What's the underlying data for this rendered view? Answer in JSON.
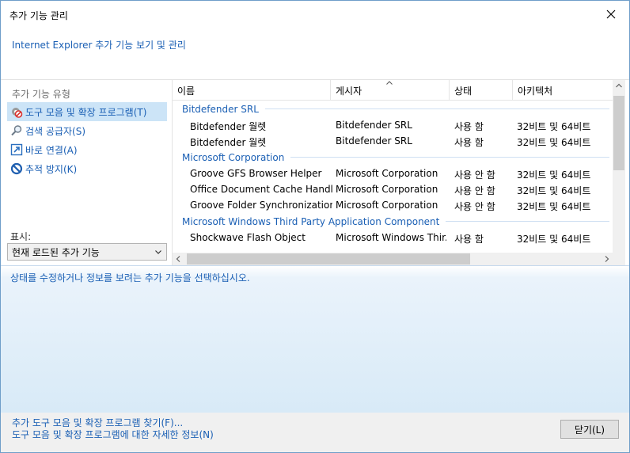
{
  "window": {
    "title": "추가 기능 관리"
  },
  "header": {
    "link": "Internet Explorer 추가 기능 보기 및 관리"
  },
  "left_panel": {
    "heading": "추가 기능 유형",
    "types": [
      {
        "label": "도구 모음 및 확장 프로그램(T)",
        "icon": "gear-block-icon",
        "selected": true
      },
      {
        "label": "검색 공급자(S)",
        "icon": "search-icon",
        "selected": false
      },
      {
        "label": "바로 연결(A)",
        "icon": "accelerator-icon",
        "selected": false
      },
      {
        "label": "추적 방지(K)",
        "icon": "tracking-protection-icon",
        "selected": false
      }
    ],
    "show_label": "표시:",
    "show_value": "현재 로드된 추가 기능"
  },
  "list": {
    "columns": [
      "이름",
      "게시자",
      "상태",
      "아키텍처"
    ],
    "groups": [
      {
        "name": "Bitdefender SRL",
        "rows": [
          {
            "name": "Bitdefender 월렛",
            "publisher": "Bitdefender SRL",
            "status": "사용 함",
            "arch": "32비트 및 64비트"
          },
          {
            "name": "Bitdefender 월렛",
            "publisher": "Bitdefender SRL",
            "status": "사용 함",
            "arch": "32비트 및 64비트"
          }
        ]
      },
      {
        "name": "Microsoft Corporation",
        "rows": [
          {
            "name": "Groove GFS Browser Helper",
            "publisher": "Microsoft Corporation",
            "status": "사용 안 함",
            "arch": "32비트 및 64비트"
          },
          {
            "name": "Office Document Cache Handler",
            "publisher": "Microsoft Corporation",
            "status": "사용 안 함",
            "arch": "32비트 및 64비트"
          },
          {
            "name": "Groove Folder Synchronization",
            "publisher": "Microsoft Corporation",
            "status": "사용 안 함",
            "arch": "32비트 및 64비트"
          }
        ]
      },
      {
        "name": "Microsoft Windows Third Party Application Component",
        "rows": [
          {
            "name": "Shockwave Flash Object",
            "publisher": "Microsoft Windows Thir...",
            "status": "사용 함",
            "arch": "32비트 및 64비트"
          }
        ]
      }
    ]
  },
  "details": {
    "text": "상태를 수정하거나 정보를 보려는 추가 기능을 선택하십시오."
  },
  "footer": {
    "link1": "추가 도구 모음 및 확장 프로그램 찾기(F)...",
    "link2": "도구 모음 및 확장 프로그램에 대한 자세한 정보(N)",
    "close_label": "닫기(L)"
  },
  "colors": {
    "link": "#1a5fb4",
    "selection": "#cce4f7",
    "border": "#6f9ec9"
  }
}
